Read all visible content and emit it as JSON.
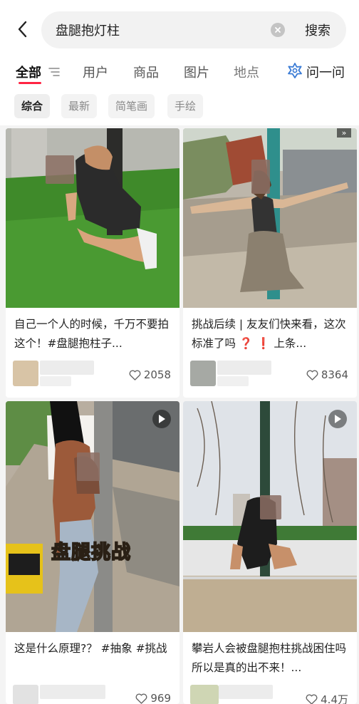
{
  "search": {
    "query": "盘腿抱灯柱",
    "button": "搜索"
  },
  "tabs": [
    {
      "label": "全部"
    },
    {
      "label": "用户"
    },
    {
      "label": "商品"
    },
    {
      "label": "图片"
    },
    {
      "label": "地点"
    },
    {
      "label": "问一问"
    }
  ],
  "chips": [
    "综合",
    "最新",
    "简笔画",
    "手绘"
  ],
  "cards": [
    {
      "title": "自己一个人的时候，千万不要拍这个！#盘腿抱柱子...",
      "likes": "2058"
    },
    {
      "title": "挑战后续 | 友友们快来看，这次标准了吗 ❓ ❗ 上条...",
      "likes": "8364"
    },
    {
      "title": "这是什么原理?？ #抽象 #挑战",
      "likes": "969",
      "overlay": "盘腿挑战"
    },
    {
      "title": "攀岩人会被盘腿抱柱挑战困住吗 所以是真的出不来！...",
      "likes": "4.4万"
    }
  ],
  "colors": {
    "accent": "#ff2442",
    "background": "#f4f4f4"
  }
}
